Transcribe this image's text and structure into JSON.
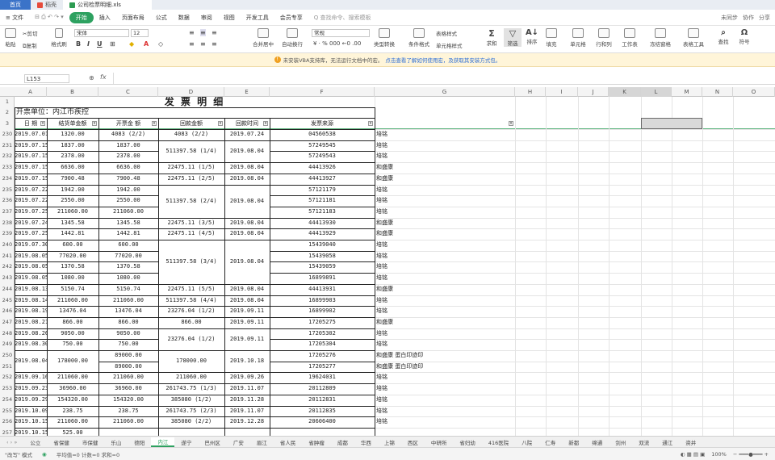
{
  "titlebar": {
    "tabs": [
      "首页",
      "稻壳",
      "公司检票明细.xls"
    ]
  },
  "menubar": {
    "items": [
      "≡ 文件",
      "开始",
      "插入",
      "页面布局",
      "公式",
      "数据",
      "审阅",
      "视图",
      "开发工具",
      "会员专享"
    ],
    "search": "Q 查找命令、搜索模板",
    "right": [
      "未同步",
      "协作",
      "分享"
    ]
  },
  "ribbon": {
    "paste": "粘贴",
    "cut": "剪切",
    "copy": "复制",
    "brush": "格式刷",
    "font": "宋体",
    "size": "12",
    "merge": "合并居中",
    "wrap": "自动换行",
    "numfmt": "常规",
    "sum": "求和",
    "filter": "筛选",
    "sort": "排序",
    "fill": "填充",
    "cell": "单元格",
    "rowcol": "行和列",
    "sheet": "工作表",
    "freeze": "冻结窗格",
    "tools": "表格工具",
    "find": "查找",
    "symbol": "符号",
    "cond": "条件格式",
    "style": "表格样式",
    "cellstyle": "单元格样式",
    "typecvt": "类型转换"
  },
  "notice": {
    "text": "未安装VBA支持库，无法运行文档中的宏。",
    "link": "点击查看了解如何使用宏，及获取其安装方式包。"
  },
  "formula": {
    "cellref": "L153",
    "fx": "fx"
  },
  "columns": [
    "A",
    "B",
    "C",
    "D",
    "E",
    "F",
    "G",
    "H",
    "I",
    "J",
    "K",
    "L",
    "M",
    "N",
    "O"
  ],
  "sheet": {
    "title": "发 票 明 细",
    "unit": "开票单位：内江市疾控",
    "headers": [
      "日 期",
      "结货单金额",
      "开票金 额",
      "回款金额",
      "回款时间",
      "发票来源"
    ],
    "rows": [
      {
        "n": "230",
        "a": "2019.07.01",
        "b": "1320.00",
        "c": "4083 (2/2)",
        "d": "4083 (2/2)",
        "e": "2019.07.24",
        "f": "04560538",
        "g": "培铭"
      },
      {
        "n": "231",
        "a": "2019.07.15",
        "b": "1837.00",
        "c": "1837.00",
        "d": "",
        "e": "",
        "f": "57249545",
        "g": "培铭"
      },
      {
        "n": "232",
        "a": "2019.07.15",
        "b": "2378.00",
        "c": "2378.00",
        "d": "",
        "e": "",
        "f": "57249543",
        "g": "培铭"
      },
      {
        "n": "233",
        "a": "2019.07.15",
        "b": "6636.00",
        "c": "6636.00",
        "d": "22475.11 (1/5)",
        "e": "2019.08.04",
        "f": "44413926",
        "g": "和盛康"
      },
      {
        "n": "234",
        "a": "2019.07.15",
        "b": "7900.48",
        "c": "7900.48",
        "d": "22475.11 (2/5)",
        "e": "2019.08.04",
        "f": "44413927",
        "g": "和盛康"
      },
      {
        "n": "235",
        "a": "2019.07.22",
        "b": "1942.00",
        "c": "1942.00",
        "d": "",
        "e": "",
        "f": "57121179",
        "g": "培铭"
      },
      {
        "n": "236",
        "a": "2019.07.22",
        "b": "2550.00",
        "c": "2550.00",
        "d": "",
        "e": "",
        "f": "57121181",
        "g": "培铭"
      },
      {
        "n": "237",
        "a": "2019.07.25",
        "b": "211060.00",
        "c": "211060.00",
        "d": "",
        "e": "",
        "f": "57121183",
        "g": "培铭"
      },
      {
        "n": "238",
        "a": "2019.07.24",
        "b": "1345.58",
        "c": "1345.58",
        "d": "22475.11 (3/5)",
        "e": "2019.08.04",
        "f": "44413930",
        "g": "和盛康"
      },
      {
        "n": "239",
        "a": "2019.07.25",
        "b": "1442.81",
        "c": "1442.81",
        "d": "22475.11 (4/5)",
        "e": "2019.08.04",
        "f": "44413929",
        "g": "和盛康"
      },
      {
        "n": "240",
        "a": "2019.07.30",
        "b": "600.00",
        "c": "600.00",
        "d": "",
        "e": "",
        "f": "15439040",
        "g": "培铭"
      },
      {
        "n": "241",
        "a": "2019.08.05",
        "b": "77020.00",
        "c": "77020.00",
        "d": "",
        "e": "",
        "f": "15439058",
        "g": "培铭"
      },
      {
        "n": "242",
        "a": "2019.08.05",
        "b": "1370.58",
        "c": "1370.58",
        "d": "",
        "e": "",
        "f": "15439059",
        "g": "培铭"
      },
      {
        "n": "243",
        "a": "2019.08.05",
        "b": "1080.00",
        "c": "1080.00",
        "d": "",
        "e": "",
        "f": "16899891",
        "g": "培铭"
      },
      {
        "n": "244",
        "a": "2019.08.13",
        "b": "5150.74",
        "c": "5150.74",
        "d": "22475.11 (5/5)",
        "e": "2019.08.04",
        "f": "44413931",
        "g": "和盛康"
      },
      {
        "n": "245",
        "a": "2019.08.14",
        "b": "211060.00",
        "c": "211060.00",
        "d": "511397.58 (4/4)",
        "e": "2019.08.04",
        "f": "16899903",
        "g": "培铭"
      },
      {
        "n": "246",
        "a": "2019.08.19",
        "b": "13476.04",
        "c": "13476.04",
        "d": "23276.04 (1/2)",
        "e": "2019.09.11",
        "f": "16899902",
        "g": "培铭"
      },
      {
        "n": "247",
        "a": "2019.08.21",
        "b": "866.00",
        "c": "866.00",
        "d": "866.00",
        "e": "2019.09.11",
        "f": "17205275",
        "g": "和盛康"
      },
      {
        "n": "248",
        "a": "2019.08.26",
        "b": "9050.00",
        "c": "9050.00",
        "d": "",
        "e": "",
        "f": "17205302",
        "g": "培铭"
      },
      {
        "n": "249",
        "a": "2019.08.30",
        "b": "750.00",
        "c": "750.00",
        "d": "",
        "e": "",
        "f": "17205304",
        "g": "培铭"
      },
      {
        "n": "250",
        "a": "",
        "b": "",
        "c": "89000.00",
        "d": "",
        "e": "",
        "f": "17205276",
        "g": "和盛康 蛋白印迹印"
      },
      {
        "n": "251",
        "a": "",
        "b": "",
        "c": "89000.00",
        "d": "",
        "e": "",
        "f": "17205277",
        "g": "和盛康 蛋白印迹印"
      },
      {
        "n": "252",
        "a": "2019.09.16",
        "b": "211060.00",
        "c": "211060.00",
        "d": "211060.00",
        "e": "2019.09.26",
        "f": "19624031",
        "g": "培铭"
      },
      {
        "n": "253",
        "a": "2019.09.23",
        "b": "36960.00",
        "c": "36960.00",
        "d": "261743.75 (1/3)",
        "e": "2019.11.07",
        "f": "20112809",
        "g": "培铭"
      },
      {
        "n": "254",
        "a": "2019.09.29",
        "b": "154320.00",
        "c": "154320.00",
        "d": "385080 (1/2)",
        "e": "2019.11.28",
        "f": "20112831",
        "g": "培铭"
      },
      {
        "n": "255",
        "a": "2019.10.09",
        "b": "238.75",
        "c": "238.75",
        "d": "261743.75 (2/3)",
        "e": "2019.11.07",
        "f": "20112835",
        "g": "培铭"
      },
      {
        "n": "256",
        "a": "2019.10.15",
        "b": "211060.00",
        "c": "211060.00",
        "d": "385080 (2/2)",
        "e": "2019.12.28",
        "f": "20606400",
        "g": "培铭"
      },
      {
        "n": "257",
        "a": "2019.10.15",
        "b": "525.00",
        "c": "",
        "d": "",
        "e": "",
        "f": "",
        "g": ""
      }
    ],
    "merged": [
      {
        "col": "d",
        "text": "511397.58 (1/4)",
        "from": 1,
        "to": 2
      },
      {
        "col": "e",
        "text": "2019.08.04",
        "from": 1,
        "to": 2
      },
      {
        "col": "d",
        "text": "511397.58 (2/4)",
        "from": 5,
        "to": 7
      },
      {
        "col": "e",
        "text": "2019.08.04",
        "from": 5,
        "to": 7
      },
      {
        "col": "d",
        "text": "511397.58 (3/4)",
        "from": 10,
        "to": 13
      },
      {
        "col": "e",
        "text": "2019.08.04",
        "from": 10,
        "to": 13
      },
      {
        "col": "d",
        "text": "23276.04 (1/2)",
        "from": 18,
        "to": 19
      },
      {
        "col": "e",
        "text": "2019.09.11",
        "from": 18,
        "to": 19
      },
      {
        "col": "a",
        "text": "2019.08.04",
        "from": 20,
        "to": 21
      },
      {
        "col": "b",
        "text": "178000.00",
        "from": 20,
        "to": 21
      },
      {
        "col": "d",
        "text": "178000.00",
        "from": 20,
        "to": 21
      },
      {
        "col": "e",
        "text": "2019.10.18",
        "from": 20,
        "to": 21
      }
    ]
  },
  "sheettabs": [
    "公立",
    "省保健",
    "市保健",
    "乐山",
    "德阳",
    "内江",
    "遂宁",
    "巴州区",
    "广安",
    "眉江",
    "省人民",
    "省肿瘤",
    "成都",
    "华西",
    "上锦",
    "西区",
    "中研所",
    "省妇幼",
    "416医院",
    "八院",
    "仁寿",
    "新都",
    "绵通",
    "剑州",
    "双流",
    "通江",
    "资并"
  ],
  "activeSheet": "内江",
  "status": {
    "mode": "\"改写\" 模式",
    "avg": "平均值=0 计数=0 求和=0",
    "zoom": "100%"
  }
}
